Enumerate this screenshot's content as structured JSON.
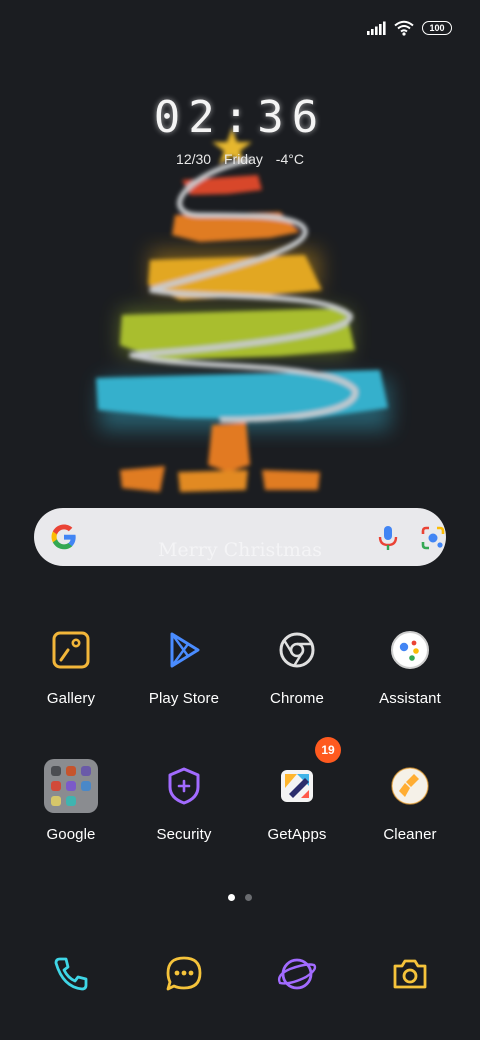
{
  "status_bar": {
    "signal_icon": "signal-bars-icon",
    "wifi_icon": "wifi-icon",
    "battery_level": "100"
  },
  "lock_widget": {
    "time": "02:36",
    "date": "12/30",
    "weekday": "Friday",
    "temperature": "-4°C"
  },
  "wallpaper": {
    "text": "Merry Christmas"
  },
  "search": {
    "logo_icon": "google-g-icon",
    "mic_icon": "microphone-icon",
    "lens_icon": "camera-lens-icon"
  },
  "apps_row1": [
    {
      "label": "Gallery",
      "icon": "gallery-icon",
      "color": "#f2b63a"
    },
    {
      "label": "Play Store",
      "icon": "play-store-icon",
      "color": "#4a8cff"
    },
    {
      "label": "Chrome",
      "icon": "chrome-icon",
      "color": "#e0e0e0"
    },
    {
      "label": "Assistant",
      "icon": "assistant-icon",
      "color": "#ffffff"
    }
  ],
  "apps_row2": [
    {
      "label": "Google",
      "icon": "folder-icon"
    },
    {
      "label": "Security",
      "icon": "security-shield-icon",
      "color": "#a26bff"
    },
    {
      "label": "GetApps",
      "icon": "getapps-icon",
      "badge": "19"
    },
    {
      "label": "Cleaner",
      "icon": "cleaner-brush-icon",
      "color": "#ffad32"
    }
  ],
  "page_indicator": {
    "pages": 2,
    "current": 1
  },
  "dock": [
    {
      "icon": "phone-icon",
      "color": "#3fd6e6"
    },
    {
      "icon": "messages-icon",
      "color": "#f5c33b"
    },
    {
      "icon": "browser-planet-icon",
      "color": "#a26bff"
    },
    {
      "icon": "camera-icon",
      "color": "#f5c33b"
    }
  ]
}
